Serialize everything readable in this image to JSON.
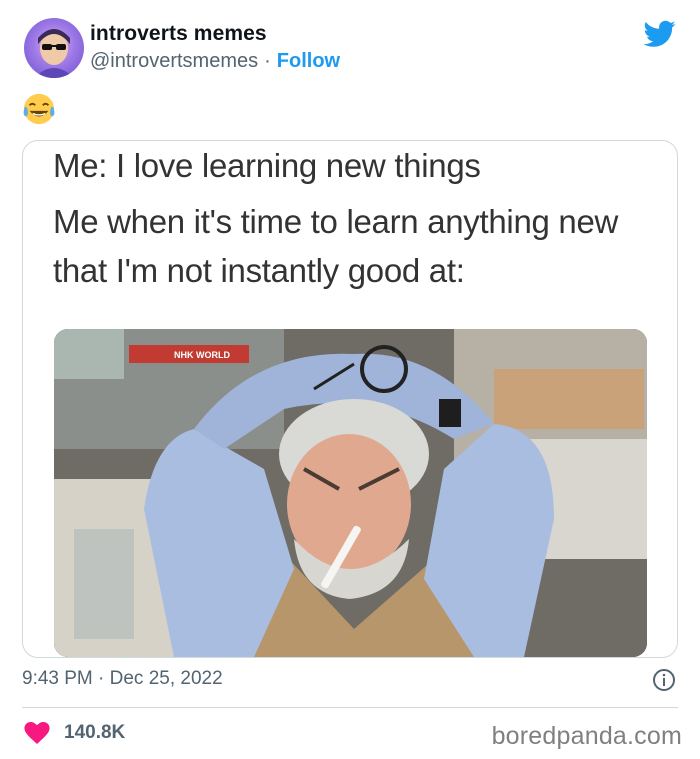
{
  "tweet": {
    "author_name": "introverts memes",
    "author_handle": "@introvertsmemes",
    "separator": "·",
    "follow_label": "Follow",
    "emoji": "😂",
    "timestamp": "9:43 PM · Dec 25, 2022",
    "likes": "140.8K"
  },
  "meme": {
    "line1": "Me: I love learning new things",
    "line2": "Me when it's time to learn anything new that I'm not instantly good at:",
    "photo_caption": "NHK WORLD"
  },
  "watermark": "boredpanda.com",
  "colors": {
    "accent": "#1d9bf0",
    "heart": "#f91880",
    "muted": "#536471"
  },
  "icons": {
    "platform": "twitter-bird-icon",
    "info": "info-icon",
    "like": "heart-icon"
  }
}
